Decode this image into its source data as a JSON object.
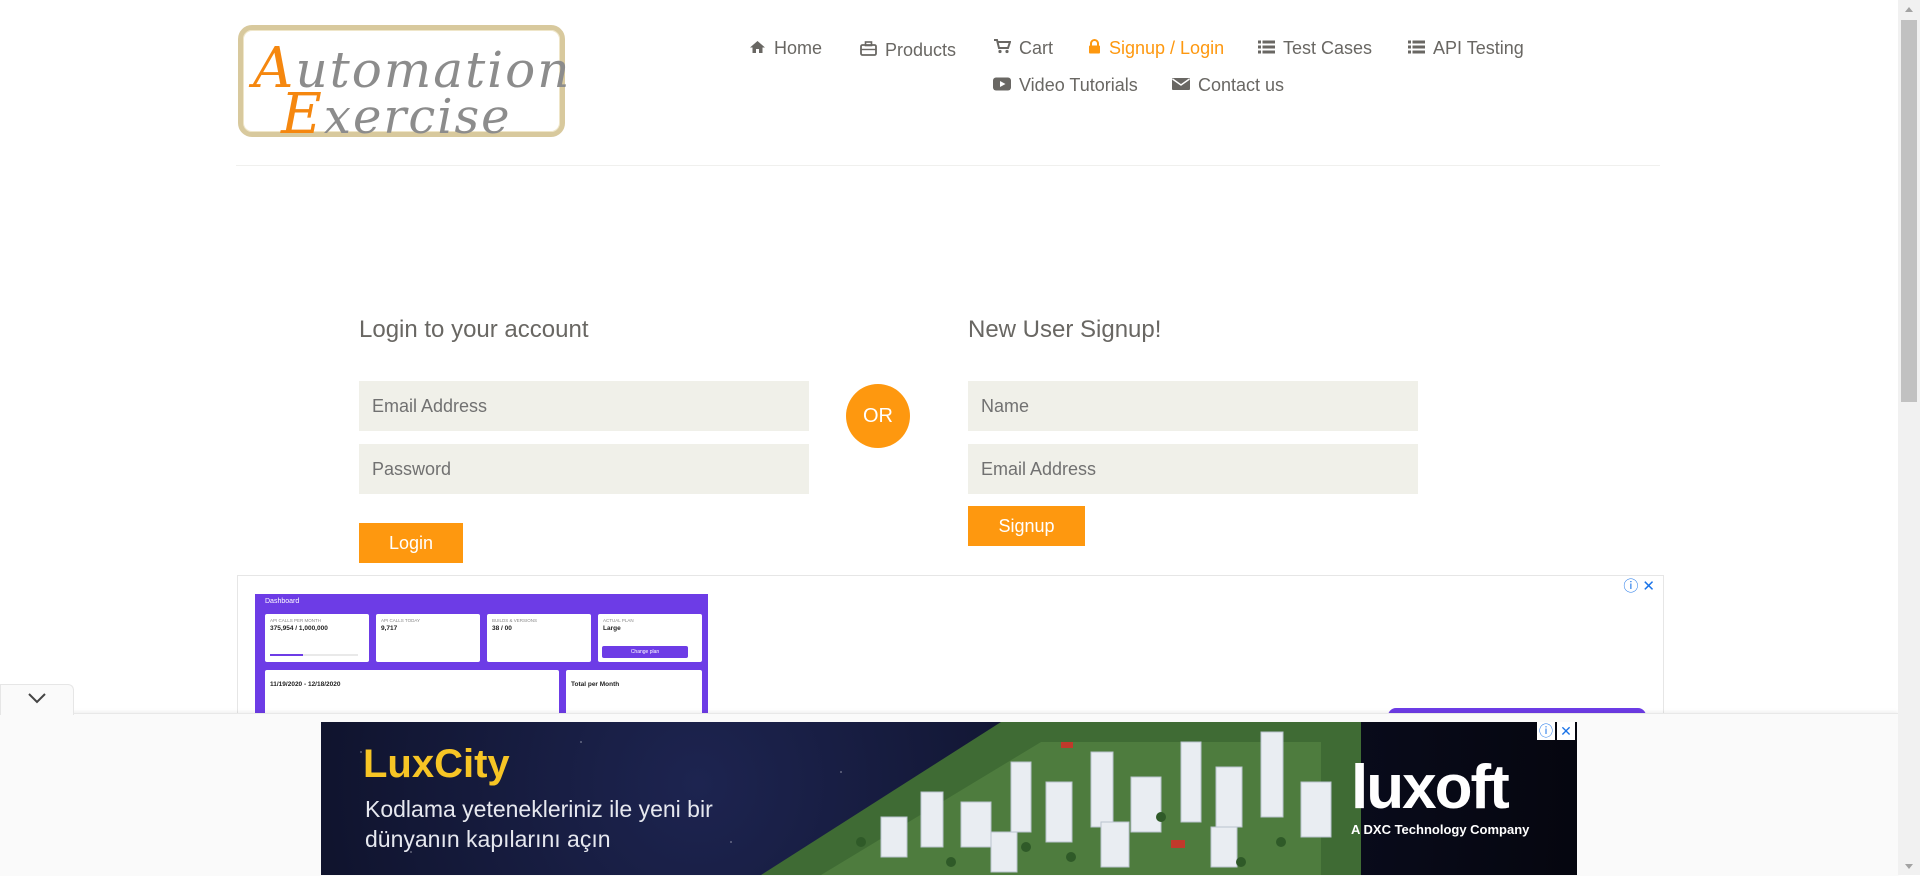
{
  "logo": {
    "line1_cap": "A",
    "line1_rest": "utomation",
    "line2_cap": "E",
    "line2_rest": "xercise"
  },
  "nav": {
    "home": "Home",
    "products": "Products",
    "cart": "Cart",
    "signup_login": "Signup / Login",
    "test_cases": "Test Cases",
    "api_testing": "API Testing",
    "video_tutorials": "Video Tutorials",
    "contact_us": "Contact us"
  },
  "login": {
    "title": "Login to your account",
    "email_placeholder": "Email Address",
    "password_placeholder": "Password",
    "button": "Login"
  },
  "or_label": "OR",
  "signup": {
    "title": "New User Signup!",
    "name_placeholder": "Name",
    "email_placeholder": "Email Address",
    "button": "Signup"
  },
  "ad_inline": {
    "dashboard_title": "Dashboard",
    "cards": [
      {
        "label": "API CALLS PER MONTH",
        "value": "375,954 / 1,000,000"
      },
      {
        "label": "API CALLS TODAY",
        "value": "9,717"
      },
      {
        "label": "BUILDS & VERSIONS",
        "value": "38 / 00"
      },
      {
        "label": "ACTUAL PLAN",
        "value": "Large"
      }
    ],
    "change_plan": "Change plan",
    "api_calls_range": "11/19/2020 - 12/18/2020",
    "total_per_month": "Total per Month"
  },
  "ad_bottom": {
    "brand": "LuxCity",
    "tagline": "Kodlama yetenekleriniz ile yeni bir dünyanın kapılarını açın",
    "company": "luxoft",
    "company_sub": "A DXC Technology Company"
  },
  "colors": {
    "accent": "#fe980f",
    "field_bg": "#f0f0e9",
    "text": "#696763"
  }
}
